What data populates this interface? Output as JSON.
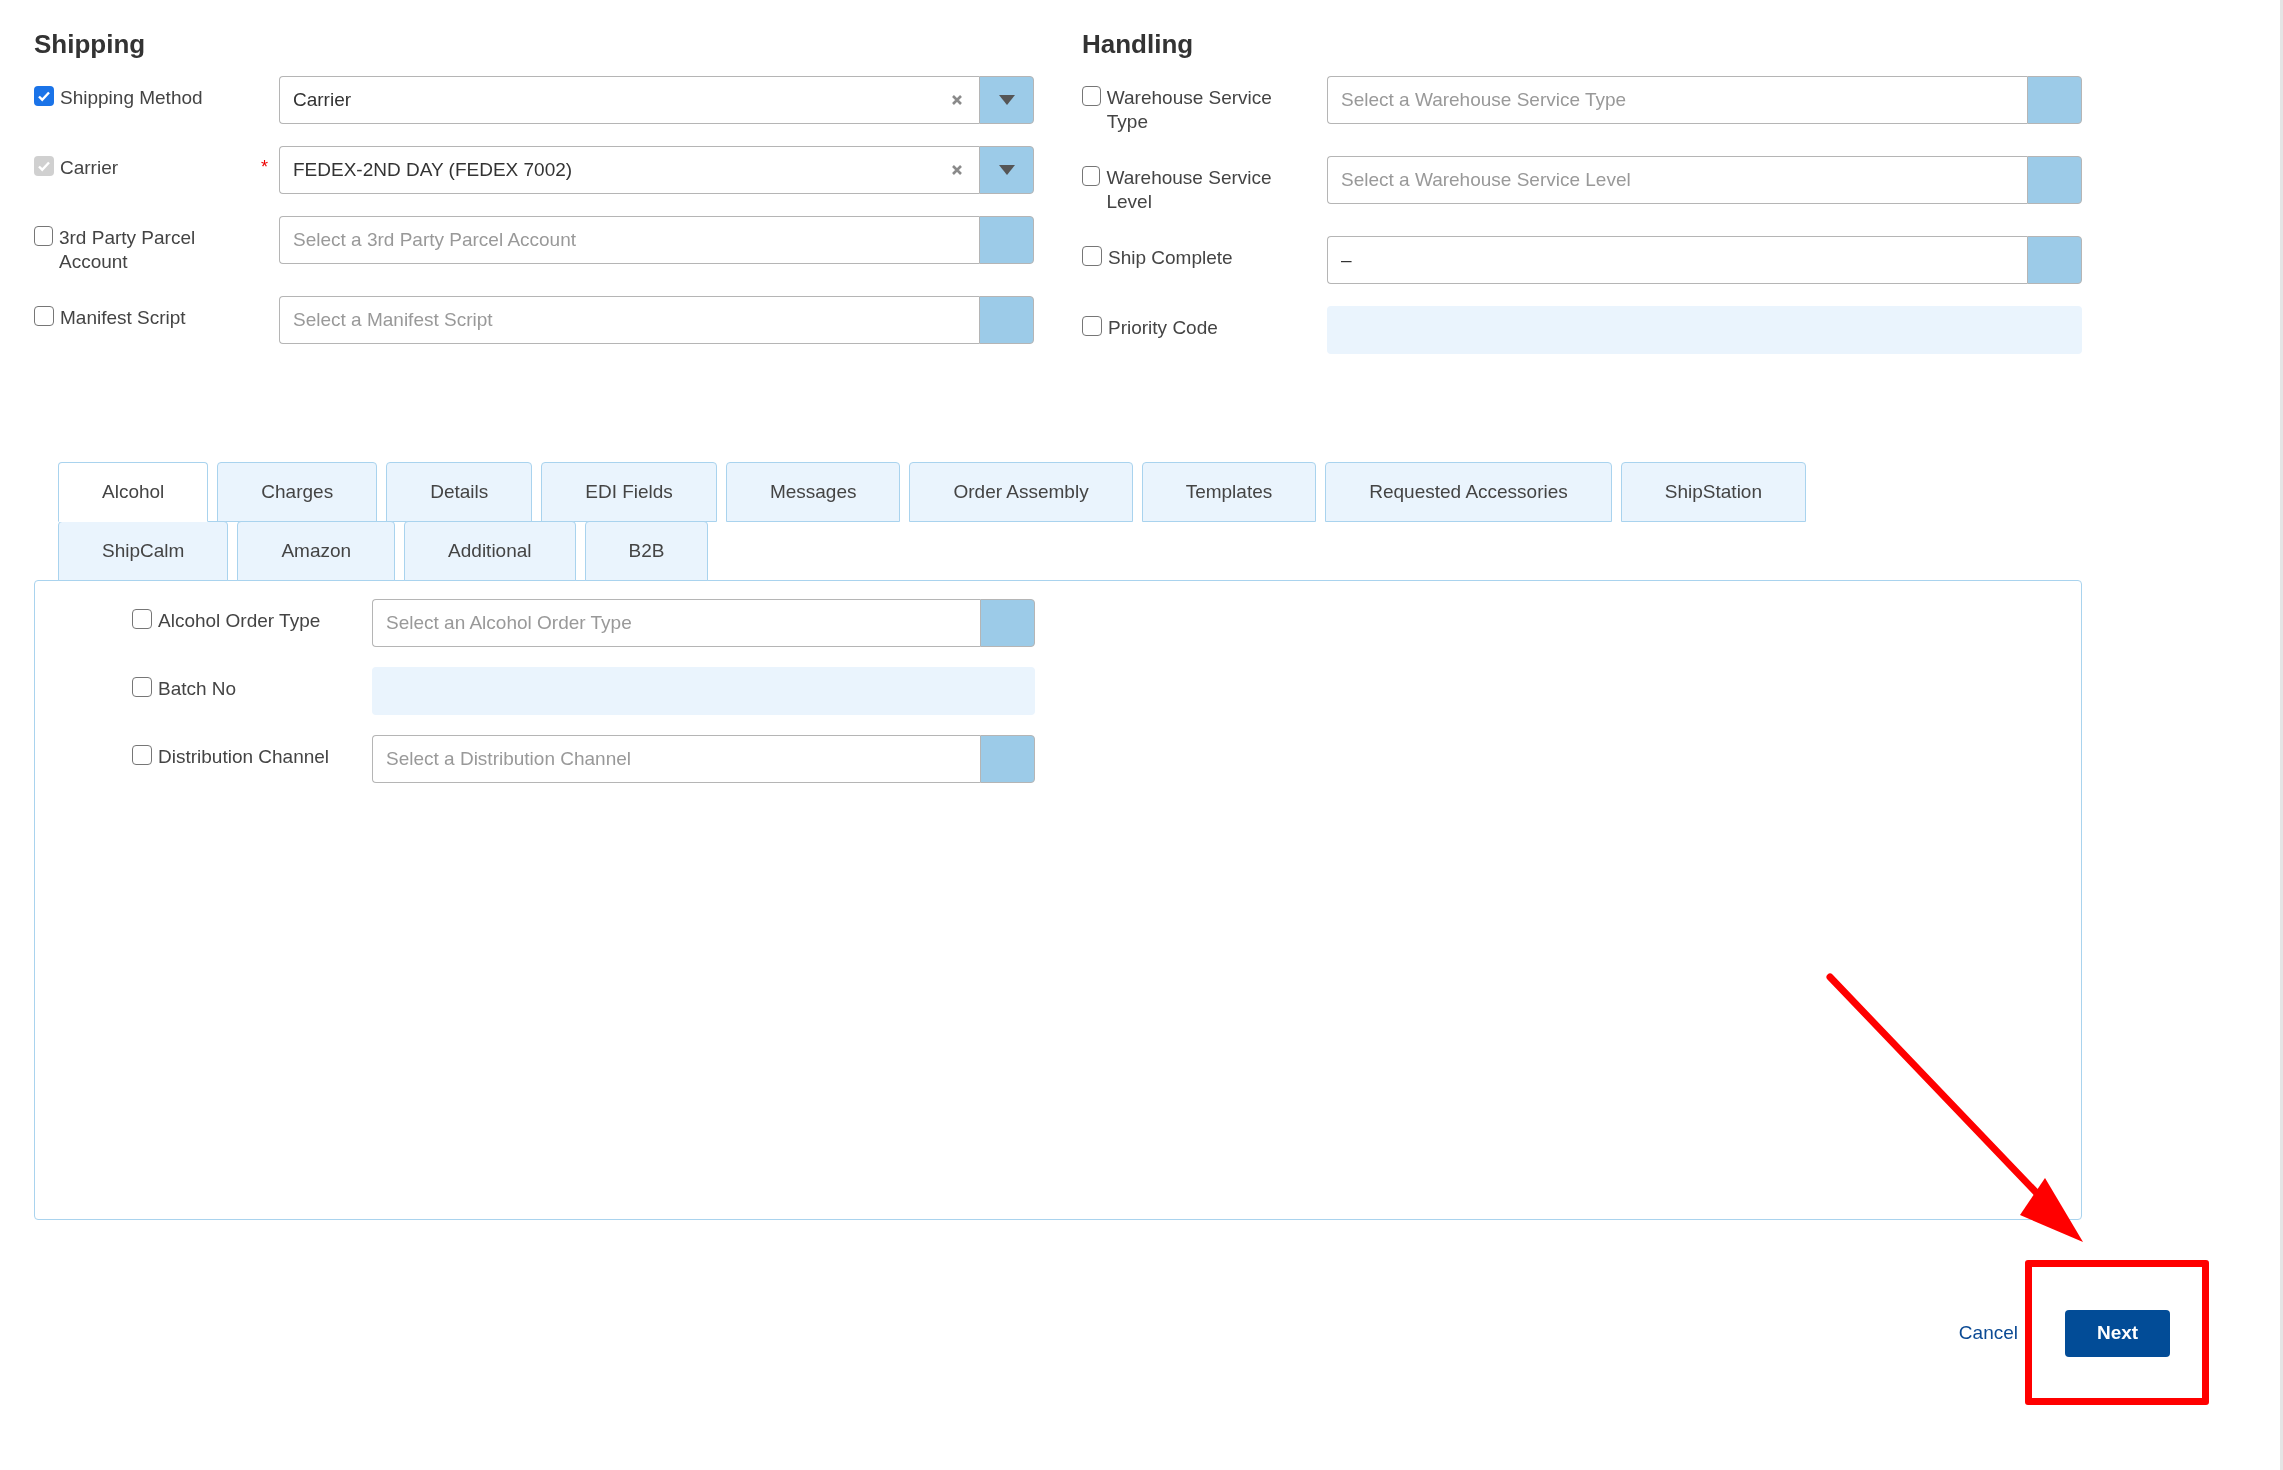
{
  "shipping": {
    "title": "Shipping",
    "fields": [
      {
        "label": "Shipping Method",
        "checked": true,
        "disabled": false,
        "kind": "select",
        "value": "Carrier",
        "clearable": true
      },
      {
        "label": "Carrier",
        "checked": true,
        "disabled": true,
        "required_mark": "*",
        "kind": "select",
        "value": "FEDEX-2ND DAY (FEDEX 7002)",
        "clearable": true
      },
      {
        "label": "3rd Party Parcel Account",
        "checked": false,
        "disabled": false,
        "kind": "select",
        "placeholder": "Select a 3rd Party Parcel Account",
        "clearable": false
      },
      {
        "label": "Manifest Script",
        "checked": false,
        "disabled": false,
        "kind": "select",
        "placeholder": "Select a Manifest Script",
        "clearable": false
      }
    ]
  },
  "handling": {
    "title": "Handling",
    "fields": [
      {
        "label": "Warehouse Service Type",
        "checked": false,
        "disabled": false,
        "kind": "select",
        "placeholder": "Select a Warehouse Service Type",
        "clearable": false
      },
      {
        "label": "Warehouse Service Level",
        "checked": false,
        "disabled": false,
        "kind": "select",
        "placeholder": "Select a Warehouse Service Level",
        "clearable": false
      },
      {
        "label": "Ship Complete",
        "checked": false,
        "disabled": false,
        "kind": "select",
        "value": "–",
        "clearable": false
      },
      {
        "label": "Priority Code",
        "checked": false,
        "disabled": false,
        "kind": "text"
      }
    ]
  },
  "tabs": [
    {
      "label": "Alcohol",
      "selected": true
    },
    {
      "label": "Charges",
      "selected": false
    },
    {
      "label": "Details",
      "selected": false
    },
    {
      "label": "EDI Fields",
      "selected": false
    },
    {
      "label": "Messages",
      "selected": false
    },
    {
      "label": "Order Assembly",
      "selected": false
    },
    {
      "label": "Templates",
      "selected": false
    },
    {
      "label": "Requested Accessories",
      "selected": false
    },
    {
      "label": "ShipStation",
      "selected": false
    },
    {
      "label": "ShipCalm",
      "selected": false
    },
    {
      "label": "Amazon",
      "selected": false
    },
    {
      "label": "Additional",
      "selected": false
    },
    {
      "label": "B2B",
      "selected": false
    }
  ],
  "tab_panel": {
    "fields": [
      {
        "label": "Alcohol Order Type",
        "checked": false,
        "disabled": false,
        "kind": "select",
        "placeholder": "Select an Alcohol Order Type",
        "clearable": false
      },
      {
        "label": "Batch No",
        "checked": false,
        "disabled": false,
        "kind": "text"
      },
      {
        "label": "Distribution Channel",
        "checked": false,
        "disabled": false,
        "kind": "select",
        "placeholder": "Select a Distribution Channel",
        "clearable": false
      }
    ]
  },
  "footer": {
    "cancel": "Cancel",
    "next": "Next"
  }
}
